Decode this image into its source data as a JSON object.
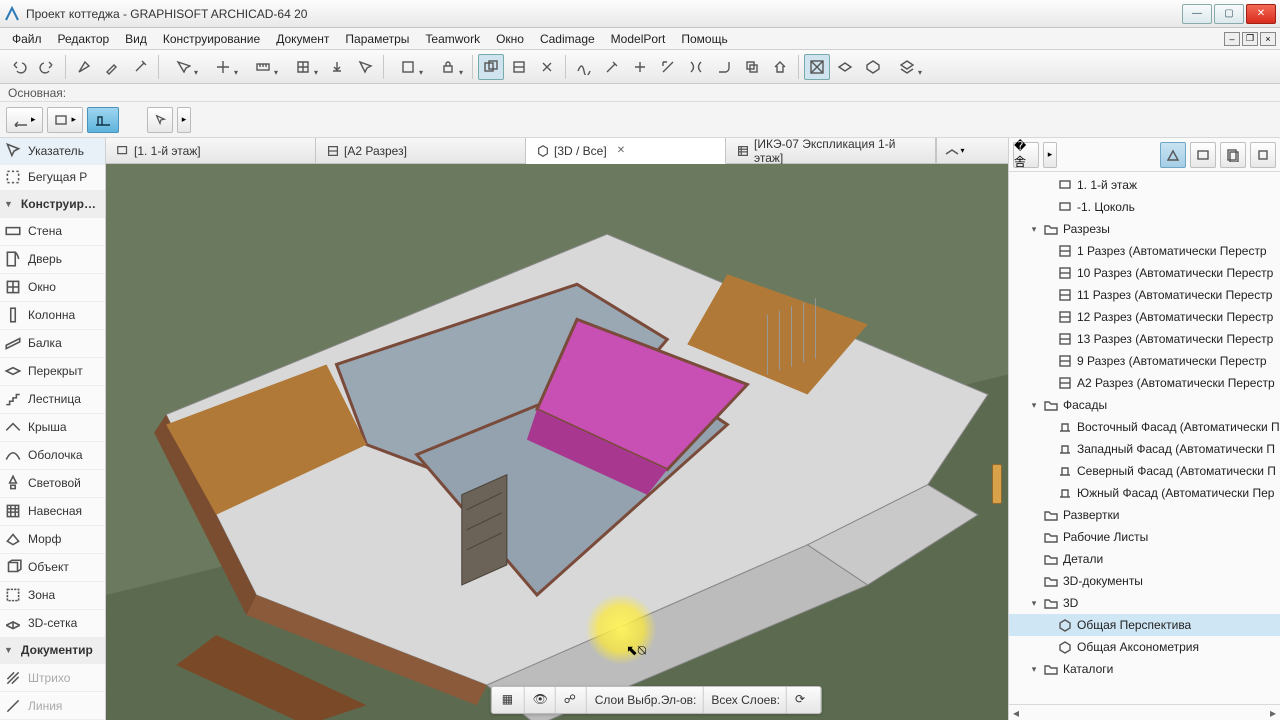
{
  "titlebar": {
    "title": "Проект коттеджа - GRAPHISOFT ARCHICAD-64 20"
  },
  "menu": [
    "Файл",
    "Редактор",
    "Вид",
    "Конструирование",
    "Документ",
    "Параметры",
    "Teamwork",
    "Окно",
    "Cadimage",
    "ModelPort",
    "Помощь"
  ],
  "infostrip": "Основная:",
  "toolbox": {
    "pointer": "Указатель",
    "marquee": "Бегущая Р",
    "group_design": "Конструирование",
    "items_design": [
      "Стена",
      "Дверь",
      "Окно",
      "Колонна",
      "Балка",
      "Перекрыт",
      "Лестница",
      "Крыша",
      "Оболочка",
      "Световой",
      "Навесная",
      "Морф",
      "Объект",
      "Зона",
      "3D-сетка"
    ],
    "group_doc": "Документир",
    "items_doc": [
      "Штрихо",
      "Линия"
    ]
  },
  "tabs": [
    {
      "label": "[1. 1-й этаж]",
      "icon": "plan"
    },
    {
      "label": "[A2 Разрез]",
      "icon": "section"
    },
    {
      "label": "[3D / Все]",
      "icon": "3d",
      "active": true,
      "closable": true
    },
    {
      "label": "[ИКЭ-07 Экспликация 1-й этаж]",
      "icon": "schedule"
    }
  ],
  "navigator": {
    "items": [
      {
        "indent": 2,
        "icon": "story",
        "label": "1. 1-й этаж"
      },
      {
        "indent": 2,
        "icon": "story",
        "label": "-1. Цоколь"
      },
      {
        "indent": 1,
        "expander": "▾",
        "icon": "folder",
        "label": "Разрезы"
      },
      {
        "indent": 2,
        "icon": "section",
        "label": "1 Разрез (Автоматически Перестр"
      },
      {
        "indent": 2,
        "icon": "section",
        "label": "10 Разрез (Автоматически Перестр"
      },
      {
        "indent": 2,
        "icon": "section",
        "label": "11 Разрез (Автоматически Перестр"
      },
      {
        "indent": 2,
        "icon": "section",
        "label": "12 Разрез (Автоматически Перестр"
      },
      {
        "indent": 2,
        "icon": "section",
        "label": "13 Разрез (Автоматически Перестр"
      },
      {
        "indent": 2,
        "icon": "section",
        "label": "9 Разрез (Автоматически Перестр"
      },
      {
        "indent": 2,
        "icon": "section",
        "label": "A2 Разрез (Автоматически Перестр"
      },
      {
        "indent": 1,
        "expander": "▾",
        "icon": "folder",
        "label": "Фасады"
      },
      {
        "indent": 2,
        "icon": "elev",
        "label": "Восточный Фасад (Автоматически П"
      },
      {
        "indent": 2,
        "icon": "elev",
        "label": "Западный Фасад (Автоматически П"
      },
      {
        "indent": 2,
        "icon": "elev",
        "label": "Северный Фасад (Автоматически П"
      },
      {
        "indent": 2,
        "icon": "elev",
        "label": "Южный Фасад (Автоматически Пер"
      },
      {
        "indent": 1,
        "icon": "folder",
        "label": "Развертки"
      },
      {
        "indent": 1,
        "icon": "folder",
        "label": "Рабочие Листы"
      },
      {
        "indent": 1,
        "icon": "folder",
        "label": "Детали"
      },
      {
        "indent": 1,
        "icon": "folder",
        "label": "3D-документы"
      },
      {
        "indent": 1,
        "expander": "▾",
        "icon": "folder",
        "label": "3D"
      },
      {
        "indent": 2,
        "icon": "3d",
        "label": "Общая Перспектива",
        "sel": true
      },
      {
        "indent": 2,
        "icon": "3d",
        "label": "Общая Аксонометрия"
      },
      {
        "indent": 1,
        "expander": "▾",
        "icon": "folder",
        "label": "Каталоги"
      }
    ]
  },
  "floatbar": {
    "layers_label": "Слои Выбр.Эл-ов:",
    "all_layers": "Всех Слоев:"
  }
}
